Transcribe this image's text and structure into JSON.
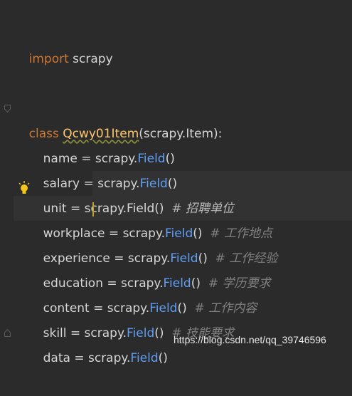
{
  "lines": [
    {
      "id": "import",
      "kw": "import",
      "rest": " scrapy"
    },
    {
      "id": "class",
      "kw": "class",
      "name": "Qcwy01Item",
      "rest": "(scrapy.Item):"
    },
    {
      "id": "name",
      "var": "name = scrapy.",
      "field": "Field",
      "call": "()",
      "comment": ""
    },
    {
      "id": "salary",
      "var": "salary = scrapy.",
      "field": "Field",
      "call": "()",
      "comment": ""
    },
    {
      "id": "unit",
      "var": "unit = scrapy.Field()",
      "comment": "# 招聘单位"
    },
    {
      "id": "workplace",
      "var_a": "workplace",
      "var_b": " = scrapy.",
      "field": "Field",
      "call": "()",
      "comment": "# 工作地点"
    },
    {
      "id": "experience",
      "var": "experience = scrapy.",
      "field": "Field",
      "call": "()",
      "comment": "# 工作经验"
    },
    {
      "id": "education",
      "var": "education = scrapy.",
      "field": "Field",
      "call": "()",
      "comment": "# 学历要求"
    },
    {
      "id": "content",
      "var": "content = scrapy.",
      "field": "Field",
      "call": "()",
      "comment": "# 工作内容"
    },
    {
      "id": "skill",
      "var": "skill = scrapy.",
      "field": "Field",
      "call": "()",
      "comment": "# 技能要求"
    },
    {
      "id": "data",
      "var": "data = scrapy.",
      "field": "Field",
      "call": "()",
      "comment": ""
    }
  ],
  "watermark": "https://blog.csdn.net/qq_39746596",
  "colors": {
    "background": "#2b2b2b",
    "keyword": "#cc7832",
    "class_name": "#ffc66d",
    "field": "#5f9ef2",
    "comment": "#808080"
  },
  "icons": {
    "fold_marker": "fold-marker-icon",
    "intention_bulb": "lightbulb-icon"
  }
}
